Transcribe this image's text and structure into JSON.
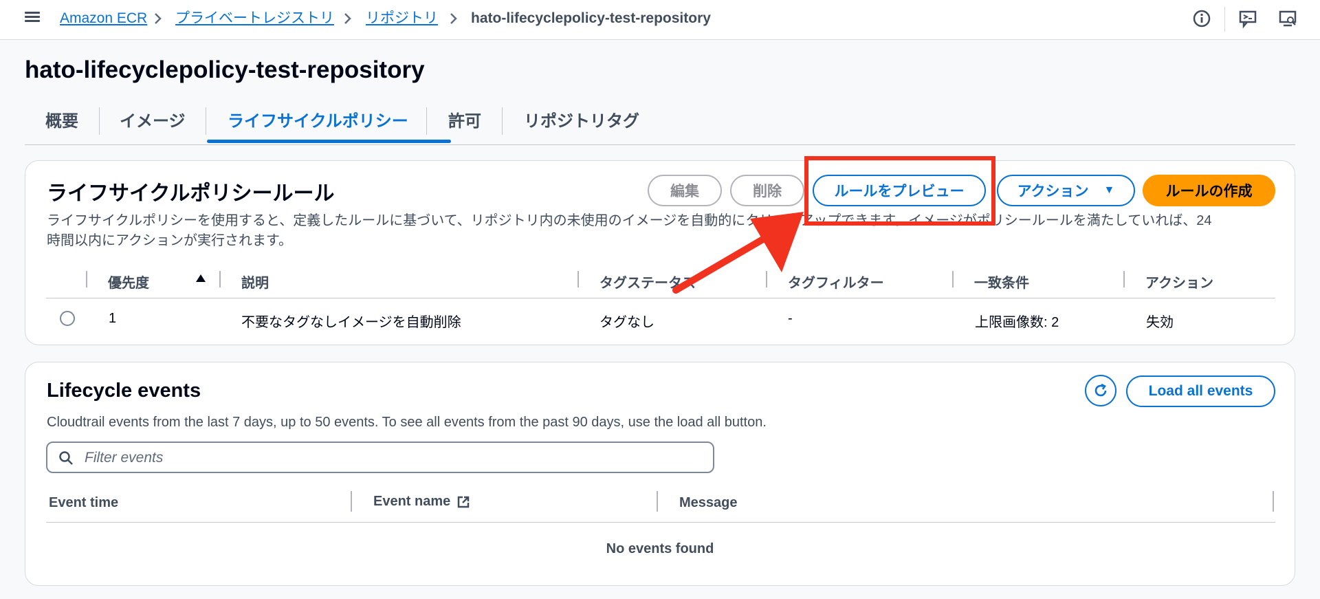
{
  "breadcrumb": {
    "items": [
      "Amazon ECR",
      "プライベートレジストリ",
      "リポジトリ"
    ],
    "current": "hato-lifecyclepolicy-test-repository"
  },
  "page": {
    "title": "hato-lifecyclepolicy-test-repository"
  },
  "tabs": [
    {
      "label": "概要"
    },
    {
      "label": "イメージ"
    },
    {
      "label": "ライフサイクルポリシー",
      "active": true
    },
    {
      "label": "許可"
    },
    {
      "label": "リポジトリタグ"
    }
  ],
  "rules": {
    "title": "ライフサイクルポリシールール",
    "description_line1": "ライフサイクルポリシーを使用すると、定義したルールに基づいて、リポジトリ内の未使用のイメージを自動的にクリーンアップできます。イメージがポリシールールを満たしていれば、24",
    "description_line2": "時間以内にアクションが実行されます。",
    "buttons": {
      "edit": "編集",
      "delete": "削除",
      "preview": "ルールをプレビュー",
      "actions": "アクション",
      "create": "ルールの作成"
    },
    "columns": [
      "優先度",
      "説明",
      "タグステータス",
      "タグフィルター",
      "一致条件",
      "アクション"
    ],
    "rows": [
      {
        "priority": "1",
        "description": "不要なタグなしイメージを自動削除",
        "tag_status": "タグなし",
        "tag_filter": "-",
        "match": "上限画像数: 2",
        "action": "失効"
      }
    ]
  },
  "events": {
    "title": "Lifecycle events",
    "description": "Cloudtrail events from the last 7 days, up to 50 events. To see all events from the past 90 days, use the load all button.",
    "load_all": "Load all events",
    "filter_placeholder": "Filter events",
    "columns": [
      "Event time",
      "Event name",
      "Message"
    ],
    "empty": "No events found"
  },
  "colors": {
    "link": "#0972d3",
    "primary": "#ff9900",
    "annotation": "#f0321f"
  },
  "icons": [
    "menu-icon",
    "chevron-right-icon",
    "info-icon",
    "feedback-icon",
    "settings-icon",
    "sort-ascending-icon",
    "search-icon",
    "refresh-icon",
    "external-link-icon",
    "caret-down-icon"
  ]
}
